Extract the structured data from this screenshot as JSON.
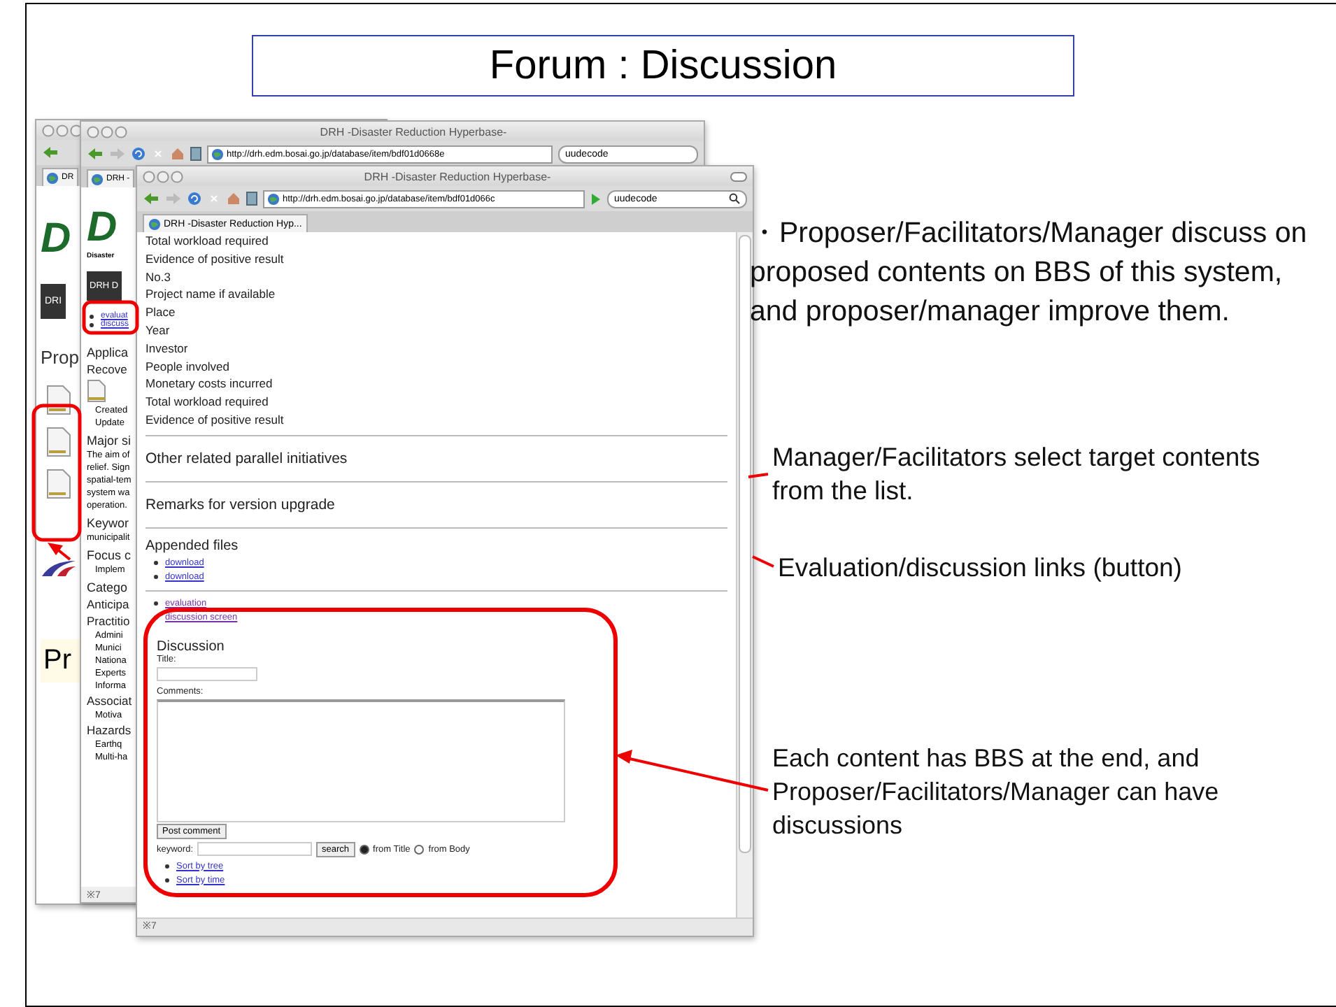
{
  "slide": {
    "title": "Forum : Discussion"
  },
  "notes": [
    {
      "text": "・Proposer/Facilitators/Manager discuss on proposed contents on BBS of this system, and proposer/manager improve them."
    },
    {
      "text": "Manager/Facilitators select target contents from the list."
    },
    {
      "text": "Evaluation/discussion links (button)"
    },
    {
      "text": "Each content has BBS at the end, and Proposer/Facilitators/Manager can have discussions"
    }
  ],
  "back_window": {
    "tab": "DR",
    "logo": "D",
    "nav": "DRI",
    "heading": "Prop",
    "footer_heading": "Pr"
  },
  "middle_window": {
    "title": "DRH -Disaster Reduction Hyperbase-",
    "url": "http://drh.edm.bosai.go.jp/database/item/bdf01d0668e",
    "search": "uudecode",
    "tab": "DRH -",
    "logo": "D",
    "logo_caption": "Disaster",
    "nav": "DRH D",
    "links": [
      "evaluat",
      "discuss"
    ],
    "column": [
      {
        "text": "Applica",
        "kind": "heading"
      },
      {
        "text": "Recove",
        "kind": "sub"
      },
      {
        "kind": "files"
      },
      {
        "text": "Created",
        "kind": "bullet"
      },
      {
        "text": "Update",
        "kind": "bullet"
      },
      {
        "text": "Major si",
        "kind": "heading"
      },
      {
        "text": "The aim of",
        "kind": "para"
      },
      {
        "text": "relief. Sign",
        "kind": "para"
      },
      {
        "text": "spatial-tem",
        "kind": "para"
      },
      {
        "text": "system wa",
        "kind": "para"
      },
      {
        "text": "operation.",
        "kind": "para"
      },
      {
        "text": "Keywor",
        "kind": "heading"
      },
      {
        "text": "municipalit",
        "kind": "para"
      },
      {
        "text": "Focus c",
        "kind": "heading"
      },
      {
        "text": "Implem",
        "kind": "bullet"
      },
      {
        "text": "Catego",
        "kind": "heading"
      },
      {
        "text": "Anticipa",
        "kind": "sub"
      },
      {
        "text": "Practitio",
        "kind": "sub"
      },
      {
        "text": "Admini",
        "kind": "bullet"
      },
      {
        "text": "Munici",
        "kind": "bullet"
      },
      {
        "text": "Nationa",
        "kind": "bullet"
      },
      {
        "text": "Experts",
        "kind": "bullet"
      },
      {
        "text": "Informa",
        "kind": "bullet"
      },
      {
        "text": "Associat",
        "kind": "sub"
      },
      {
        "text": "Motiva",
        "kind": "bullet"
      },
      {
        "text": "Hazards",
        "kind": "sub"
      },
      {
        "text": "Earthq",
        "kind": "bullet"
      },
      {
        "text": "Multi-ha",
        "kind": "bullet"
      }
    ],
    "status": "※7"
  },
  "front_window": {
    "title": "DRH -Disaster Reduction Hyperbase-",
    "url": "http://drh.edm.bosai.go.jp/database/item/bdf01d066c",
    "search": "uudecode",
    "tab": "DRH -Disaster Reduction Hyp...",
    "fields": [
      "Total workload required",
      "Evidence of positive result",
      "No.3",
      "Project name if available",
      "Place",
      "Year",
      "Investor",
      "People involved",
      "Monetary costs incurred",
      "Total workload required",
      "Evidence of positive result"
    ],
    "sections": [
      "Other related parallel initiatives",
      "Remarks for version upgrade"
    ],
    "appended_files": {
      "heading": "Appended files",
      "links": [
        "download",
        "download"
      ]
    },
    "links": [
      "evaluation",
      "discussion screen"
    ],
    "discussion": {
      "heading": "Discussion",
      "title_label": "Title:",
      "comments_label": "Comments:",
      "post_button": "Post comment",
      "keyword_label": "keyword:",
      "search_button": "search",
      "scopes": [
        {
          "label": "from Title",
          "selected": true
        },
        {
          "label": "from Body",
          "selected": false
        }
      ],
      "sort_links": [
        "Sort by tree",
        "Sort by time"
      ]
    },
    "status": "※7"
  }
}
